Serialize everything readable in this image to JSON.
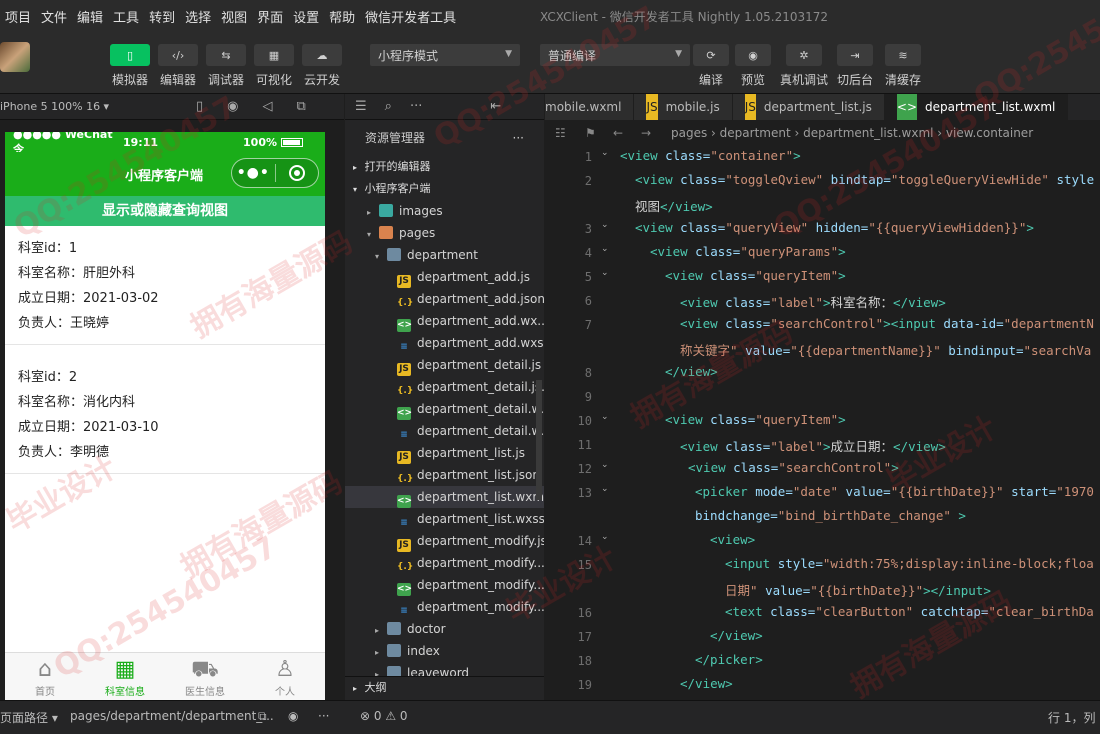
{
  "menu": [
    "项目",
    "文件",
    "编辑",
    "工具",
    "转到",
    "选择",
    "视图",
    "界面",
    "设置",
    "帮助",
    "微信开发者工具"
  ],
  "window_title": "XCXClient - 微信开发者工具 Nightly 1.05.2103172",
  "toolbar": {
    "left_tools": [
      {
        "label": "模拟器",
        "icon": "phone-icon",
        "glyph": "▯",
        "active": true
      },
      {
        "label": "编辑器",
        "icon": "code-icon",
        "glyph": "‹/›",
        "active": false
      },
      {
        "label": "调试器",
        "icon": "debug-icon",
        "glyph": "⇆",
        "active": false
      },
      {
        "label": "可视化",
        "icon": "layout-icon",
        "glyph": "▦",
        "active": false
      },
      {
        "label": "云开发",
        "icon": "cloud-icon",
        "glyph": "☁",
        "active": false
      }
    ],
    "mode_select": "小程序模式",
    "compile_select": "普通编译",
    "right_tools": [
      {
        "label": "编译",
        "icon": "refresh-icon",
        "glyph": "⟳"
      },
      {
        "label": "预览",
        "icon": "eye-icon",
        "glyph": "◉"
      },
      {
        "label": "真机调试",
        "icon": "bug-icon",
        "glyph": "✲"
      },
      {
        "label": "切后台",
        "icon": "switch-icon",
        "glyph": "⇥"
      },
      {
        "label": "清缓存",
        "icon": "layers-icon",
        "glyph": "≋"
      }
    ]
  },
  "simulator": {
    "device": "iPhone 5 100% 16 ▾",
    "status": {
      "carrier": "●●●●● WeChat令",
      "time": "19:11",
      "battery": "100%"
    },
    "nav_title": "小程序客户端",
    "toggle_button": "显示或隐藏查询视图",
    "records": [
      [
        "科室id：1",
        "科室名称：肝胆外科",
        "成立日期：2021-03-02",
        "负责人：王晓婷"
      ],
      [
        "科室id：2",
        "科室名称：消化内科",
        "成立日期：2021-03-10",
        "负责人：李明德"
      ]
    ],
    "tabbar": [
      {
        "label": "首页",
        "icon": "home-icon",
        "glyph": "⌂",
        "active": false
      },
      {
        "label": "科室信息",
        "icon": "grid-icon",
        "glyph": "▦",
        "active": true
      },
      {
        "label": "医生信息",
        "icon": "cart-icon",
        "glyph": "⛟",
        "active": false
      },
      {
        "label": "个人",
        "icon": "user-icon",
        "glyph": "♙",
        "active": false
      }
    ]
  },
  "explorer": {
    "title": "资源管理器",
    "more": "···",
    "section_open": "打开的编辑器",
    "section_project": "小程序客户端",
    "rows": [
      {
        "name": "images",
        "type": "folder-img",
        "indent": 22,
        "arrow": "▸"
      },
      {
        "name": "pages",
        "type": "folder-pages",
        "indent": 22,
        "arrow": "▾"
      },
      {
        "name": "department",
        "type": "folder",
        "indent": 30,
        "arrow": "▾"
      },
      {
        "name": "department_add.js",
        "type": "js",
        "indent": 52
      },
      {
        "name": "department_add.json",
        "type": "json",
        "indent": 52
      },
      {
        "name": "department_add.wx...",
        "type": "wxml",
        "indent": 52
      },
      {
        "name": "department_add.wxss",
        "type": "wxss",
        "indent": 52
      },
      {
        "name": "department_detail.js",
        "type": "js",
        "indent": 52
      },
      {
        "name": "department_detail.js...",
        "type": "json",
        "indent": 52
      },
      {
        "name": "department_detail.w...",
        "type": "wxml",
        "indent": 52
      },
      {
        "name": "department_detail.w...",
        "type": "wxss",
        "indent": 52
      },
      {
        "name": "department_list.js",
        "type": "js",
        "indent": 52
      },
      {
        "name": "department_list.json",
        "type": "json",
        "indent": 52
      },
      {
        "name": "department_list.wxml",
        "type": "wxml",
        "indent": 52,
        "selected": true
      },
      {
        "name": "department_list.wxss",
        "type": "wxss",
        "indent": 52
      },
      {
        "name": "department_modify.js",
        "type": "js",
        "indent": 52
      },
      {
        "name": "department_modify....",
        "type": "json",
        "indent": 52
      },
      {
        "name": "department_modify....",
        "type": "wxml",
        "indent": 52
      },
      {
        "name": "department_modify....",
        "type": "wxss",
        "indent": 52
      },
      {
        "name": "doctor",
        "type": "folder",
        "indent": 30,
        "arrow": "▸"
      },
      {
        "name": "index",
        "type": "folder",
        "indent": 30,
        "arrow": "▸"
      },
      {
        "name": "leaveword",
        "type": "folder",
        "indent": 30,
        "arrow": "▸"
      }
    ],
    "outline": "大纲"
  },
  "editor": {
    "tabs": [
      {
        "name": "mobile.wxml",
        "type": "wxml",
        "active": false
      },
      {
        "name": "mobile.js",
        "type": "js",
        "active": false
      },
      {
        "name": "department_list.js",
        "type": "js",
        "active": false
      },
      {
        "name": "department_list.wxml",
        "type": "wxml",
        "active": true
      }
    ],
    "breadcrumb": [
      "pages",
      "department",
      "department_list.wxml",
      "view.container"
    ],
    "lines": [
      {
        "n": "1",
        "fold": true,
        "indent": 0,
        "parts": [
          [
            "tag",
            "<view "
          ],
          [
            "attr",
            "class="
          ],
          [
            "str",
            "\"container\""
          ],
          [
            "tag",
            ">"
          ]
        ]
      },
      {
        "n": "2",
        "fold": false,
        "indent": 1,
        "parts": [
          [
            "tag",
            "<view "
          ],
          [
            "attr",
            "class="
          ],
          [
            "str",
            "\"toggleQview\" "
          ],
          [
            "attr",
            "bindtap="
          ],
          [
            "str",
            "\"toggleQueryViewHide\" "
          ],
          [
            "attr",
            "style"
          ]
        ]
      },
      {
        "n": "",
        "fold": false,
        "indent": 1,
        "parts": [
          [
            "txt",
            "视图"
          ],
          [
            "tag",
            "</view>"
          ]
        ]
      },
      {
        "n": "3",
        "fold": true,
        "indent": 1,
        "parts": [
          [
            "tag",
            "<view "
          ],
          [
            "attr",
            "class="
          ],
          [
            "str",
            "\"queryView\" "
          ],
          [
            "attr",
            "hidden="
          ],
          [
            "str",
            "\"{{queryViewHidden}}\""
          ],
          [
            "tag",
            ">"
          ]
        ]
      },
      {
        "n": "4",
        "fold": true,
        "indent": 2,
        "parts": [
          [
            "tag",
            "<view "
          ],
          [
            "attr",
            "class="
          ],
          [
            "str",
            "\"queryParams\""
          ],
          [
            "tag",
            ">"
          ]
        ]
      },
      {
        "n": "5",
        "fold": true,
        "indent": 3,
        "parts": [
          [
            "tag",
            "<view "
          ],
          [
            "attr",
            "class="
          ],
          [
            "str",
            "\"queryItem\""
          ],
          [
            "tag",
            ">"
          ]
        ]
      },
      {
        "n": "6",
        "fold": false,
        "indent": 4,
        "parts": [
          [
            "tag",
            "<view "
          ],
          [
            "attr",
            "class="
          ],
          [
            "str",
            "\"label\""
          ],
          [
            "tag",
            ">"
          ],
          [
            "txt",
            "科室名称："
          ],
          [
            "tag",
            "</view>"
          ]
        ]
      },
      {
        "n": "7",
        "fold": false,
        "indent": 4,
        "parts": [
          [
            "tag",
            "<view "
          ],
          [
            "attr",
            "class="
          ],
          [
            "str",
            "\"searchControl\""
          ],
          [
            "tag",
            "><input "
          ],
          [
            "attr",
            "data-id="
          ],
          [
            "str",
            "\"departmentN"
          ]
        ]
      },
      {
        "n": "",
        "fold": false,
        "indent": 4,
        "parts": [
          [
            "str",
            "称关键字\" "
          ],
          [
            "attr",
            "value="
          ],
          [
            "str",
            "\"{{departmentName}}\" "
          ],
          [
            "attr",
            "bindinput="
          ],
          [
            "str",
            "\"searchVa"
          ]
        ]
      },
      {
        "n": "8",
        "fold": false,
        "indent": 3,
        "parts": [
          [
            "tag",
            "</view>"
          ]
        ]
      },
      {
        "n": "9",
        "fold": false,
        "indent": 0,
        "parts": []
      },
      {
        "n": "10",
        "fold": true,
        "indent": 3,
        "parts": [
          [
            "tag",
            "<view "
          ],
          [
            "attr",
            "class="
          ],
          [
            "str",
            "\"queryItem\""
          ],
          [
            "tag",
            ">"
          ]
        ]
      },
      {
        "n": "11",
        "fold": false,
        "indent": 4,
        "parts": [
          [
            "tag",
            "<view "
          ],
          [
            "attr",
            "class="
          ],
          [
            "str",
            "\"label\""
          ],
          [
            "tag",
            ">"
          ],
          [
            "txt",
            "成立日期："
          ],
          [
            "tag",
            "</view>"
          ]
        ]
      },
      {
        "n": "12",
        "fold": true,
        "indent": 4.5,
        "parts": [
          [
            "tag",
            "<view "
          ],
          [
            "attr",
            "class="
          ],
          [
            "str",
            "\"searchControl\""
          ],
          [
            "tag",
            ">"
          ]
        ]
      },
      {
        "n": "13",
        "fold": true,
        "indent": 5,
        "parts": [
          [
            "tag",
            "<picker "
          ],
          [
            "attr",
            "mode="
          ],
          [
            "str",
            "\"date\" "
          ],
          [
            "attr",
            "value="
          ],
          [
            "str",
            "\"{{birthDate}}\" "
          ],
          [
            "attr",
            "start="
          ],
          [
            "str",
            "\"1970"
          ]
        ]
      },
      {
        "n": "",
        "fold": false,
        "indent": 5,
        "parts": [
          [
            "attr",
            "bindchange="
          ],
          [
            "str",
            "\"bind_birthDate_change\" "
          ],
          [
            "tag",
            ">"
          ]
        ]
      },
      {
        "n": "14",
        "fold": true,
        "indent": 6,
        "parts": [
          [
            "tag",
            "<view>"
          ]
        ]
      },
      {
        "n": "15",
        "fold": false,
        "indent": 7,
        "parts": [
          [
            "tag",
            "<input "
          ],
          [
            "attr",
            "style="
          ],
          [
            "str",
            "\"width:75%;display:inline-block;floa"
          ]
        ]
      },
      {
        "n": "",
        "fold": false,
        "indent": 7,
        "parts": [
          [
            "str",
            "日期\" "
          ],
          [
            "attr",
            "value="
          ],
          [
            "str",
            "\"{{birthDate}}\""
          ],
          [
            "tag",
            "></input>"
          ]
        ]
      },
      {
        "n": "16",
        "fold": false,
        "indent": 7,
        "parts": [
          [
            "tag",
            "<text "
          ],
          [
            "attr",
            "class="
          ],
          [
            "str",
            "\"clearButton\" "
          ],
          [
            "attr",
            "catchtap="
          ],
          [
            "str",
            "\"clear_birthDa"
          ]
        ]
      },
      {
        "n": "17",
        "fold": false,
        "indent": 6,
        "parts": [
          [
            "tag",
            "</view>"
          ]
        ]
      },
      {
        "n": "18",
        "fold": false,
        "indent": 5,
        "parts": [
          [
            "tag",
            "</picker>"
          ]
        ]
      },
      {
        "n": "19",
        "fold": false,
        "indent": 4,
        "parts": [
          [
            "tag",
            "</view>"
          ]
        ]
      }
    ]
  },
  "statusbar": {
    "page_path_label": "页面路径 ▾",
    "page_path": "pages/department/department_...",
    "problems": "⊗ 0 ⚠ 0",
    "cursor": "行 1，列"
  },
  "watermarks": [
    "QQ:254540457",
    "拥有海量源码",
    "毕业设计",
    "QQ:254540457",
    "拥有海量源码",
    "QQ:254540457",
    "毕业设计",
    "拥有海量源码",
    "QQ:254540457",
    "拥有海量源码",
    "QQ:254540457",
    "毕业设计"
  ]
}
